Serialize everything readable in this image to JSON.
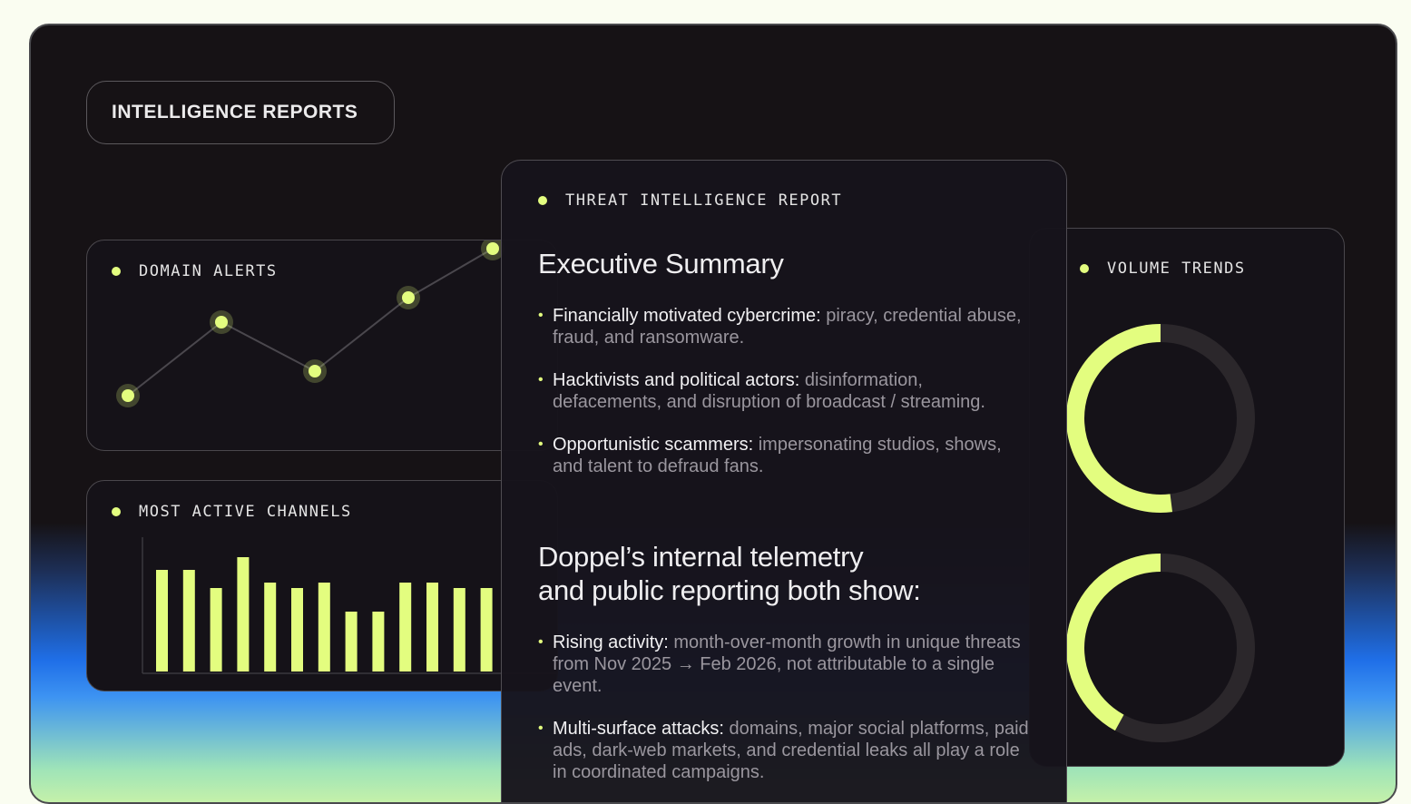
{
  "header": {
    "title": "INTELLIGENCE REPORTS"
  },
  "domain_alerts": {
    "title": "DOMAIN ALERTS",
    "chart_data": {
      "type": "line",
      "values": [
        1,
        4,
        2,
        5,
        7
      ]
    }
  },
  "active_channels": {
    "title": "MOST ACTIVE CHANNELS",
    "chart_data": {
      "type": "bar",
      "values": [
        112,
        112,
        92,
        126,
        98,
        92,
        98,
        66,
        66,
        98,
        98,
        92,
        92
      ]
    }
  },
  "report": {
    "title": "THREAT INTELLIGENCE REPORT",
    "section1": {
      "heading": "Executive Summary",
      "items": [
        {
          "label": "Financially motivated cybercrime:",
          "text": " piracy, credential abuse, fraud, and ransomware."
        },
        {
          "label": "Hacktivists and political actors:",
          "text": " disinformation, defacements, and disruption of broadcast / streaming."
        },
        {
          "label": "Opportunistic scammers:",
          "text": " impersonating studios, shows, and talent to defraud fans."
        }
      ]
    },
    "section2": {
      "heading_line1": "Doppel’s internal telemetry",
      "heading_line2": "and public reporting both show:",
      "items": [
        {
          "label": "Rising activity:",
          "text": " month-over-month growth in unique threats from Nov 2025 → Feb 2026, not attributable to a single event."
        },
        {
          "label": "Multi-surface attacks:",
          "text": " domains, major social platforms, paid ads, dark-web markets, and credential leaks all play a role in coordinated campaigns."
        }
      ]
    }
  },
  "volume_trends": {
    "title": "VOLUME TRENDS",
    "chart_data": {
      "type": "donut",
      "fractions": [
        0.52,
        0.42
      ]
    }
  },
  "colors": {
    "accent": "#e3fd7f",
    "track": "#2b272b",
    "panel": "#151218"
  }
}
